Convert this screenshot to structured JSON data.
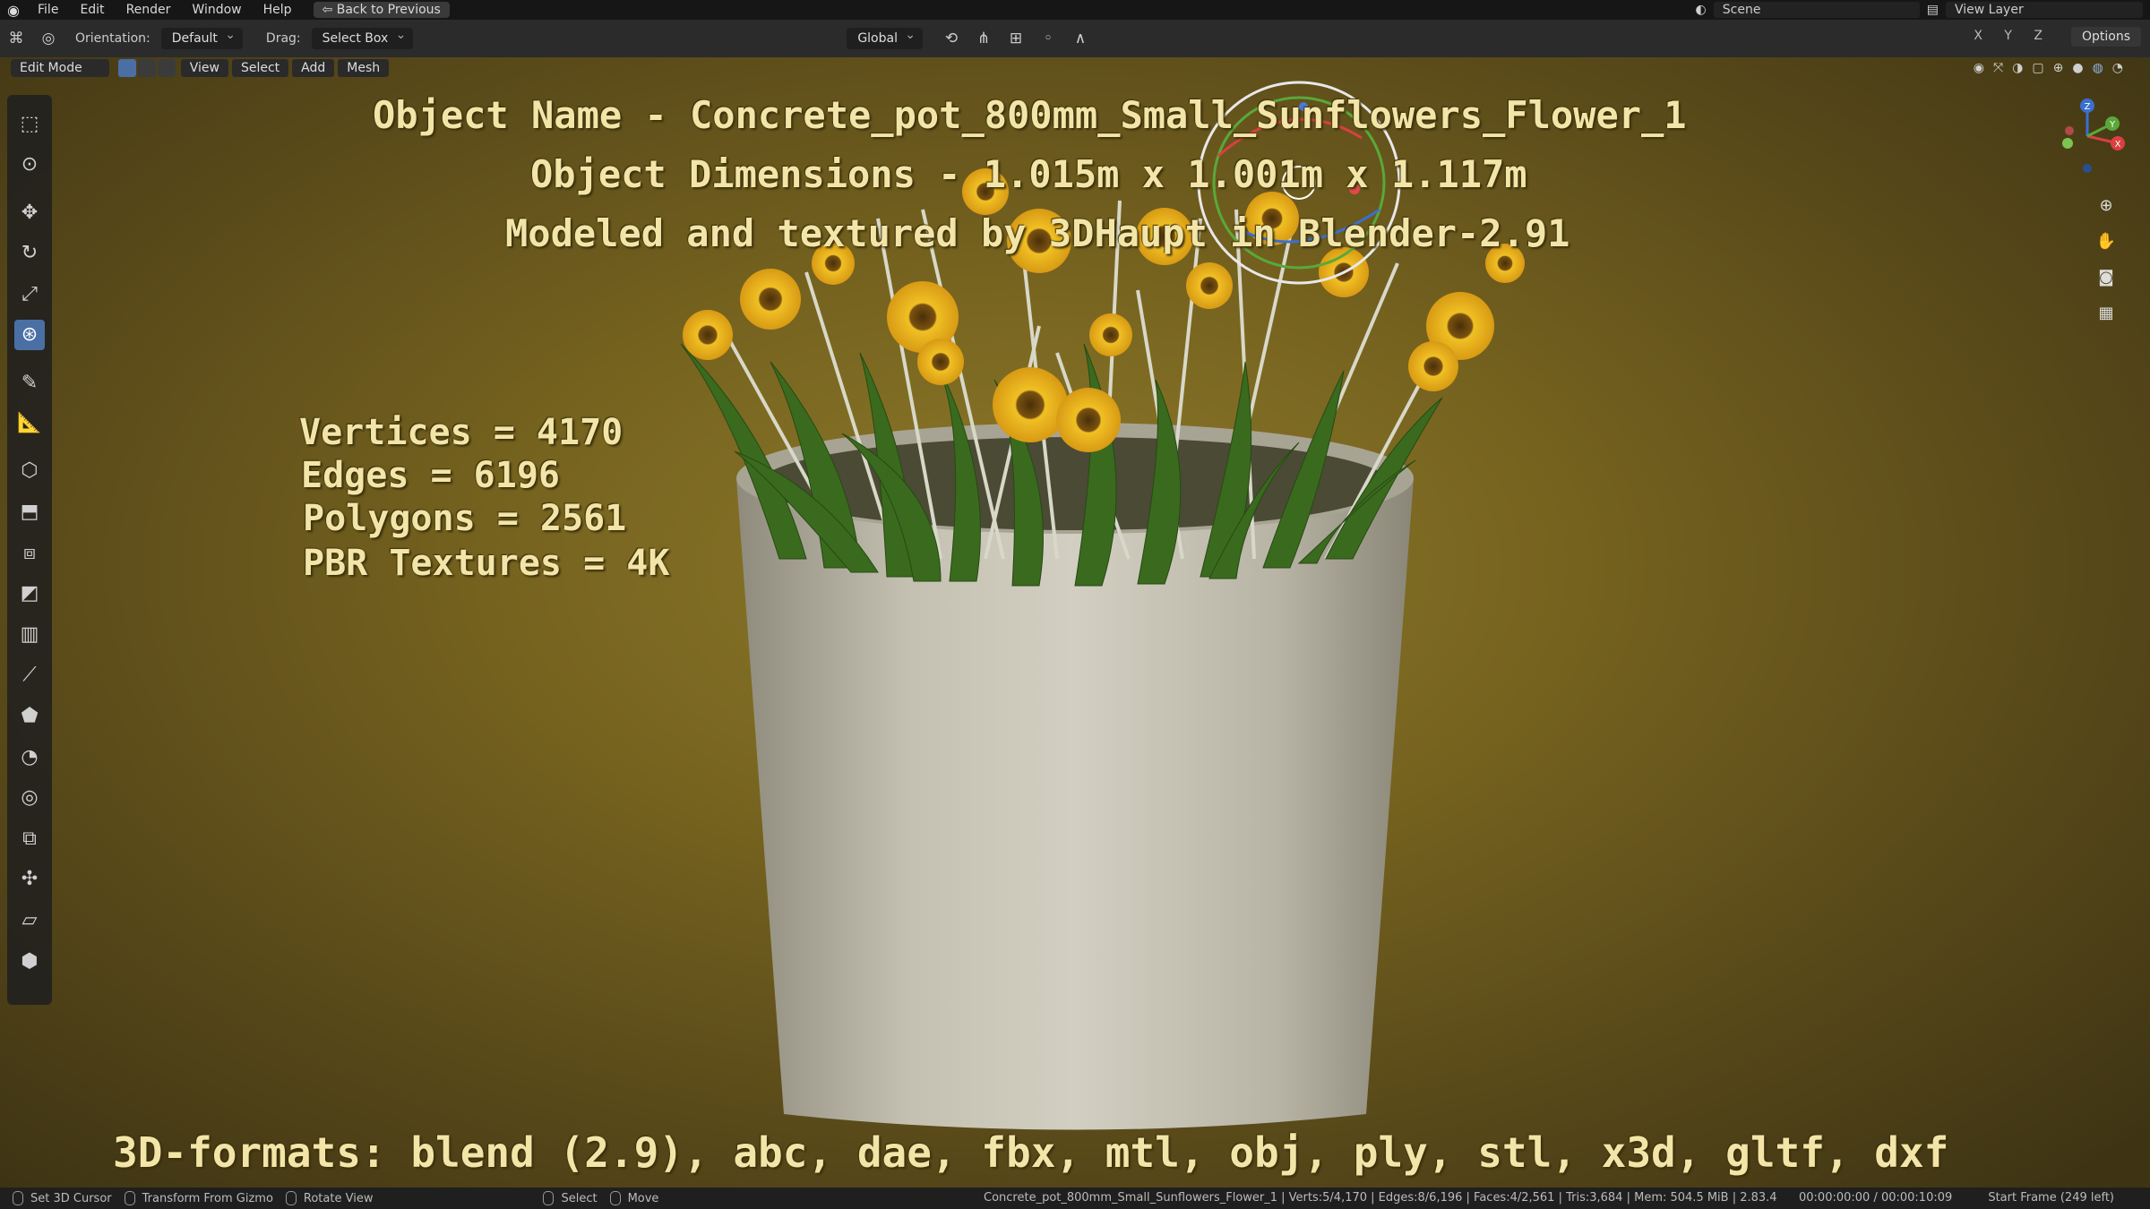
{
  "menu": {
    "file": "File",
    "edit": "Edit",
    "render": "Render",
    "window": "Window",
    "help": "Help",
    "back": "Back to Previous",
    "scene": "Scene",
    "view_layer": "View Layer"
  },
  "header": {
    "orientation_label": "Orientation:",
    "orientation_value": "Default",
    "drag_label": "Drag:",
    "drag_value": "Select Box",
    "transform_orientation": "Global",
    "axes": "X Y Z",
    "options": "Options"
  },
  "viewport_header": {
    "mode": "Edit Mode",
    "view": "View",
    "select": "Select",
    "add": "Add",
    "mesh": "Mesh"
  },
  "overlay": {
    "object_name": "Object Name - Concrete_pot_800mm_Small_Sunflowers_Flower_1",
    "dimensions": "Object Dimensions - 1.015m x 1.001m x 1.117m",
    "credit": "Modeled and textured by 3DHaupt in Blender-2.91",
    "vertices": "Vertices = 4170",
    "edges": "Edges = 6196",
    "polygons": "Polygons = 2561",
    "textures": "PBR Textures = 4K",
    "formats": "3D-formats: blend (2.9), abc, dae, fbx, mtl, obj, ply, stl, x3d, gltf, dxf"
  },
  "status": {
    "set_cursor": "Set 3D Cursor",
    "transform_gizmo": "Transform From Gizmo",
    "rotate_view": "Rotate View",
    "select": "Select",
    "move": "Move",
    "info": "Concrete_pot_800mm_Small_Sunflowers_Flower_1 | Verts:5/4,170 | Edges:8/6,196 | Faces:4/2,561 | Tris:3,684 | Mem: 504.5 MiB | 2.83.4",
    "time": "00:00:00:00 / 00:00:10:09",
    "frame": "Start Frame (249 left)"
  },
  "gizmo_axes": {
    "x": "X",
    "y": "Y",
    "z": "Z"
  },
  "colors": {
    "accent": "#4a6fa5",
    "overlay_text": "#f3e5a8",
    "background": "#7a6620",
    "pot": "#c9c6b8",
    "sunflower": "#e8b520"
  },
  "tools": [
    "select-box-icon",
    "cursor-icon",
    "move-icon",
    "rotate-icon",
    "scale-icon",
    "transform-icon",
    "annotate-icon",
    "measure-icon",
    "add-cube-icon",
    "extrude-icon",
    "inset-icon",
    "bevel-icon",
    "loop-cut-icon",
    "knife-icon",
    "poly-build-icon",
    "spin-icon",
    "smooth-icon",
    "edge-slide-icon",
    "shrink-fatten-icon",
    "shear-icon",
    "rip-icon"
  ]
}
